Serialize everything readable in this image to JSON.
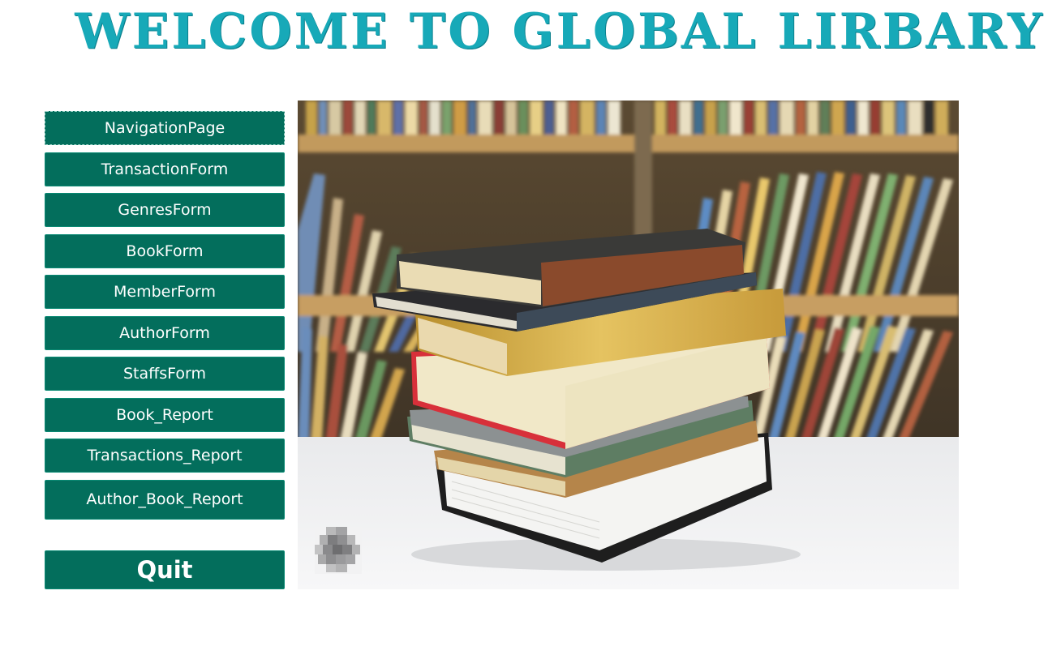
{
  "header": {
    "title": "WELCOME TO GLOBAL LIRBARY"
  },
  "nav": {
    "buttons": [
      {
        "label": "NavigationPage"
      },
      {
        "label": "TransactionForm"
      },
      {
        "label": "GenresForm"
      },
      {
        "label": "BookForm"
      },
      {
        "label": "MemberForm"
      },
      {
        "label": "AuthorForm"
      },
      {
        "label": "StaffsForm"
      },
      {
        "label": "Book_Report"
      },
      {
        "label": "Transactions_Report"
      },
      {
        "label": "Author_Book_Report"
      }
    ],
    "quit_label": "Quit"
  },
  "colors": {
    "title": "#17a9b8",
    "button": "#036e5c",
    "button_text": "#ffffff"
  }
}
